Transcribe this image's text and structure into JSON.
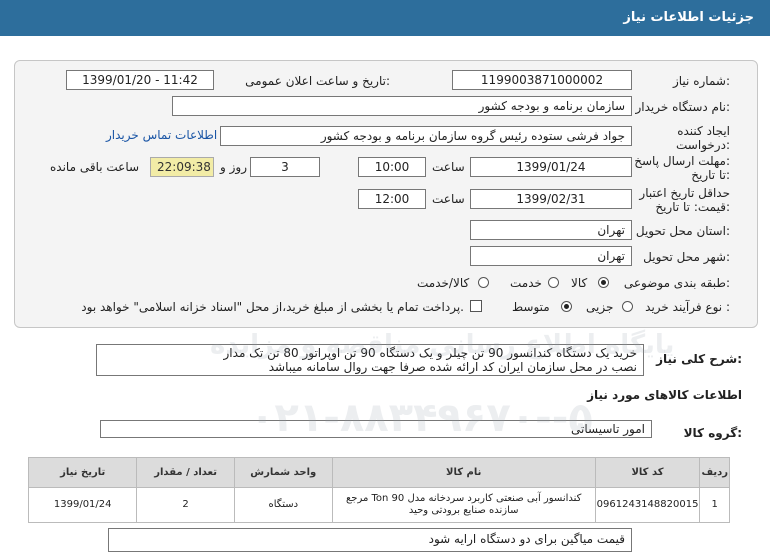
{
  "header": {
    "title": "جزئیات اطلاعات نیاز"
  },
  "form": {
    "need_number_label": "شماره نیاز:",
    "need_number": "1199003871000002",
    "announce_label": "تاریخ و ساعت اعلان عمومی:",
    "announce_value": "1399/01/20 - 11:42",
    "buyer_label": "نام دستگاه خریدار:",
    "buyer_value": "سازمان برنامه و بودجه کشور",
    "creator_label_1": "ایجاد کننده",
    "creator_label_2": "درخواست:",
    "creator_value": "جواد فرشی ستوده رئیس گروه سازمان برنامه و بودجه کشور",
    "contact_link": "اطلاعات تماس خریدار",
    "reply_label_1": "مهلت ارسال پاسخ:",
    "reply_label_2": "تا تاریخ:",
    "reply_date": "1399/01/24",
    "time_label": "ساعت",
    "reply_time": "10:00",
    "days_value": "3",
    "days_label": "روز و",
    "remaining_time": "22:09:38",
    "remaining_label": "ساعت باقی مانده",
    "price_label_1": "حداقل تاریخ اعتبار",
    "price_label_2": "قیمت: تا تاریخ:",
    "price_date": "1399/02/31",
    "price_time": "12:00",
    "province_label": "استان محل تحویل:",
    "province_value": "تهران",
    "city_label": "شهر محل تحویل:",
    "city_value": "تهران",
    "category_label": "طبقه بندی موضوعی:",
    "category_options": [
      "کالا",
      "خدمت",
      "کالا/خدمت"
    ],
    "process_label": "نوع فرآیند خرید :",
    "process_options": [
      "جزیی",
      "متوسط"
    ],
    "payment_note": "پرداخت تمام یا بخشی از مبلغ خرید،از محل \"اسناد خزانه اسلامی\" خواهد بود."
  },
  "description": {
    "label": "شرح کلی نیاز:",
    "line1": "خرید یک دستگاه کندانسور 90 تن چیلر و یک دستگاه 90 تن اوپراتور 80 تن تک مدار",
    "line2": "نصب در محل سازمان ایران کد ارائه شده صرفا جهت روال سامانه میباشد"
  },
  "goods_section": {
    "title": "اطلاعات کالاهای مورد نیاز"
  },
  "goods_group": {
    "label": "گروه کالا:",
    "value": "امور تاسیساتی"
  },
  "table": {
    "headers": [
      "ردیف",
      "کد کالا",
      "نام کالا",
      "واحد شمارش",
      "تعداد / مقدار",
      "تاریخ نیاز"
    ],
    "rows": [
      {
        "row": "1",
        "code": "0961243148820015",
        "name_line1": "کندانسور آبی صنعتی کاربرد سردخانه مدل Ton 90 مرجع",
        "name_line2": "سازنده صنایع برودتی وحید",
        "unit": "دستگاه",
        "qty": "2",
        "date": "1399/01/24"
      }
    ]
  },
  "notes": {
    "line1": "قیمت میاگین برای دو دستگاه ارایه شود"
  },
  "watermark": {
    "line1": "پایگاه اطلاع رسانی مناقصه و مزایده",
    "line2": "۰۲۱-۸۸۳۴۹۶۷۰--۵"
  }
}
